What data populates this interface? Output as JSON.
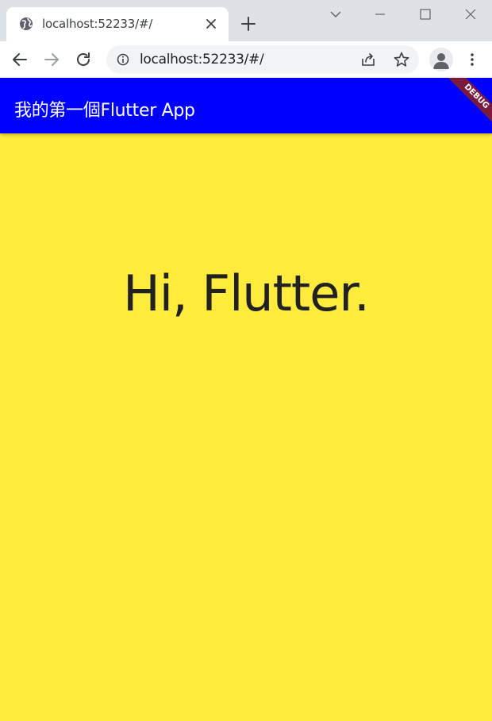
{
  "browser": {
    "tab": {
      "title": "localhost:52233/#/",
      "favicon": "globe-icon"
    },
    "address_bar": {
      "url": "localhost:52233/#/"
    },
    "colors": {
      "tabstrip": "#dee1e6",
      "toolbar": "#ffffff"
    }
  },
  "app": {
    "appbar": {
      "title": "我的第一個Flutter App",
      "color": "#0000ff"
    },
    "debug_banner": {
      "label": "DEBUG",
      "color": "#7a1b3e"
    },
    "body": {
      "text": "Hi, Flutter.",
      "background": "#ffeb3b"
    }
  }
}
